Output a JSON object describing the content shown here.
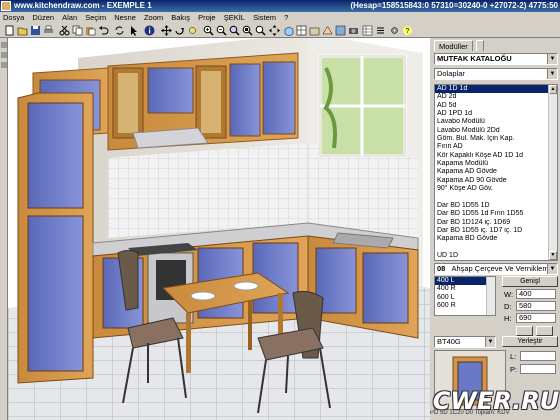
{
  "window": {
    "title": "www.kitchendraw.com - EXEMPLE 1",
    "coords": "(Hesap=158515843:0 57310=30240-0 +27072-2) 4775:50"
  },
  "menu": [
    "Dosya",
    "Düzen",
    "Alan",
    "Seçim",
    "Nesne",
    "Zoom",
    "Bakış",
    "Proje",
    "ŞEKİL",
    "Sistem",
    "?"
  ],
  "toolbar": {
    "icons": [
      "new-icon",
      "open-icon",
      "save-icon",
      "print-icon",
      "cut-icon",
      "copy-icon",
      "paste-icon",
      "undo-icon",
      "info-icon",
      "move-icon",
      "rotate-icon",
      "refresh-icon",
      "zoom-in-icon",
      "zoom-out-icon",
      "zoom-area-icon",
      "zoom-all-icon",
      "pan-icon",
      "view-3d-icon",
      "camera-icon",
      "light-icon",
      "render-icon",
      "plan-icon",
      "elevation-icon",
      "perspective-icon",
      "table-icon",
      "list-icon",
      "settings-icon"
    ]
  },
  "panel": {
    "tab_label": "Modüller",
    "catalog": "MUTFAK KATALOĞU",
    "category": "Dolaplar",
    "list_items": [
      "AD 1D 1d",
      "AD 2d",
      "AD 5d",
      "AD 1PD 1d",
      "Lavabo Modülü",
      "Lavabo Modülü 2Dd",
      "Göm. Bul. Mak. İçin Kap.",
      "Fırın AD",
      "Kör Kapaklı Köşe AD 1D 1d",
      "Kapama Modülü",
      "Kapama AD Gövde",
      "Kapama AD 90 Gövde",
      "90° Köşe AD Göv.",
      "",
      "Dar BD 1D55 1D",
      "Dar BD 1D55 1d Fırın 1D55",
      "Dar BD 1D124 iç. 1D69",
      "Dar BD 1D55 iç. 1D7 iç. 1D",
      "Kapama BD Gövde",
      "",
      "ÜD 1D"
    ],
    "material_code": "08",
    "material_name": "Ahşap Çerçeve Ve Vernikleme",
    "widths": [
      "400 L",
      "400 R",
      "600 L",
      "600 R"
    ],
    "wide_button": "Genişl",
    "w_label": "W:",
    "w_value": "400",
    "d_label": "D:",
    "d_value": "580",
    "h_label": "H:",
    "h_value": "690",
    "model": "BT40G",
    "place_button": "Yerleştir",
    "l_label": "L:",
    "p_label": "P:"
  },
  "watermark": "CWER.RU",
  "status": "PD 5D 1C20 D0 Toplam: KDV Dahil: 27473"
}
